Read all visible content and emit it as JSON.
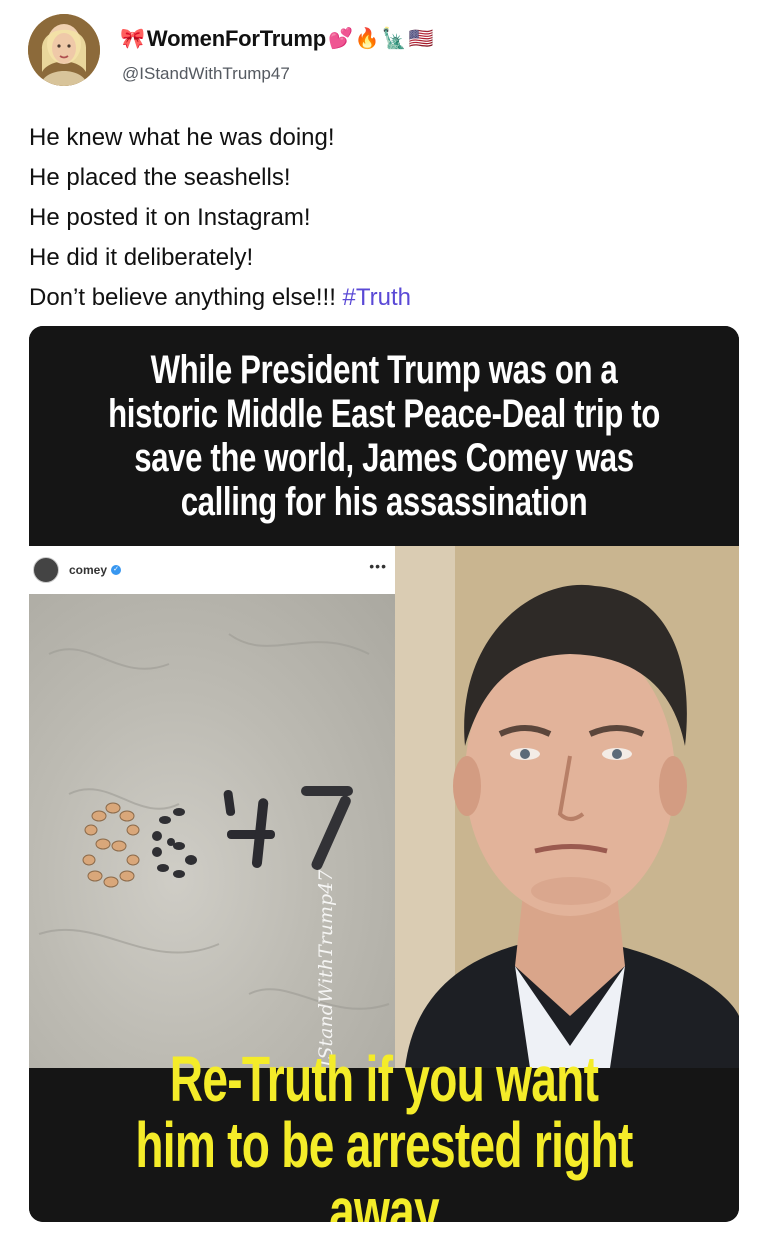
{
  "author": {
    "display_name": "WomenForTrump",
    "handle": "@IStandWithTrump47",
    "name_emojis": [
      "🎀",
      "💕",
      "🔥",
      "🗽",
      "🇺🇸"
    ],
    "avatar_icon": "profile-photo"
  },
  "post": {
    "lines": [
      "He knew what he was doing!",
      "He placed the seashells!",
      "He posted it on Instagram!",
      "He did it deliberately!",
      "Don’t believe anything else!!!"
    ],
    "hashtag": "#Truth",
    "hashtag_color": "#5a49d6"
  },
  "meme": {
    "top_text": "While President Trump was on a historic Middle East Peace-Deal trip to save the world, James Comey was calling for his assassination",
    "bottom_text": "Re-Truth if you want him to be arrested right away",
    "bottom_text_color": "#f4ec29",
    "instagram_username": "comey",
    "instagram_more_icon": "more-dots-icon",
    "shell_digits": "8647",
    "watermark": "@IStandWithTrump47"
  }
}
